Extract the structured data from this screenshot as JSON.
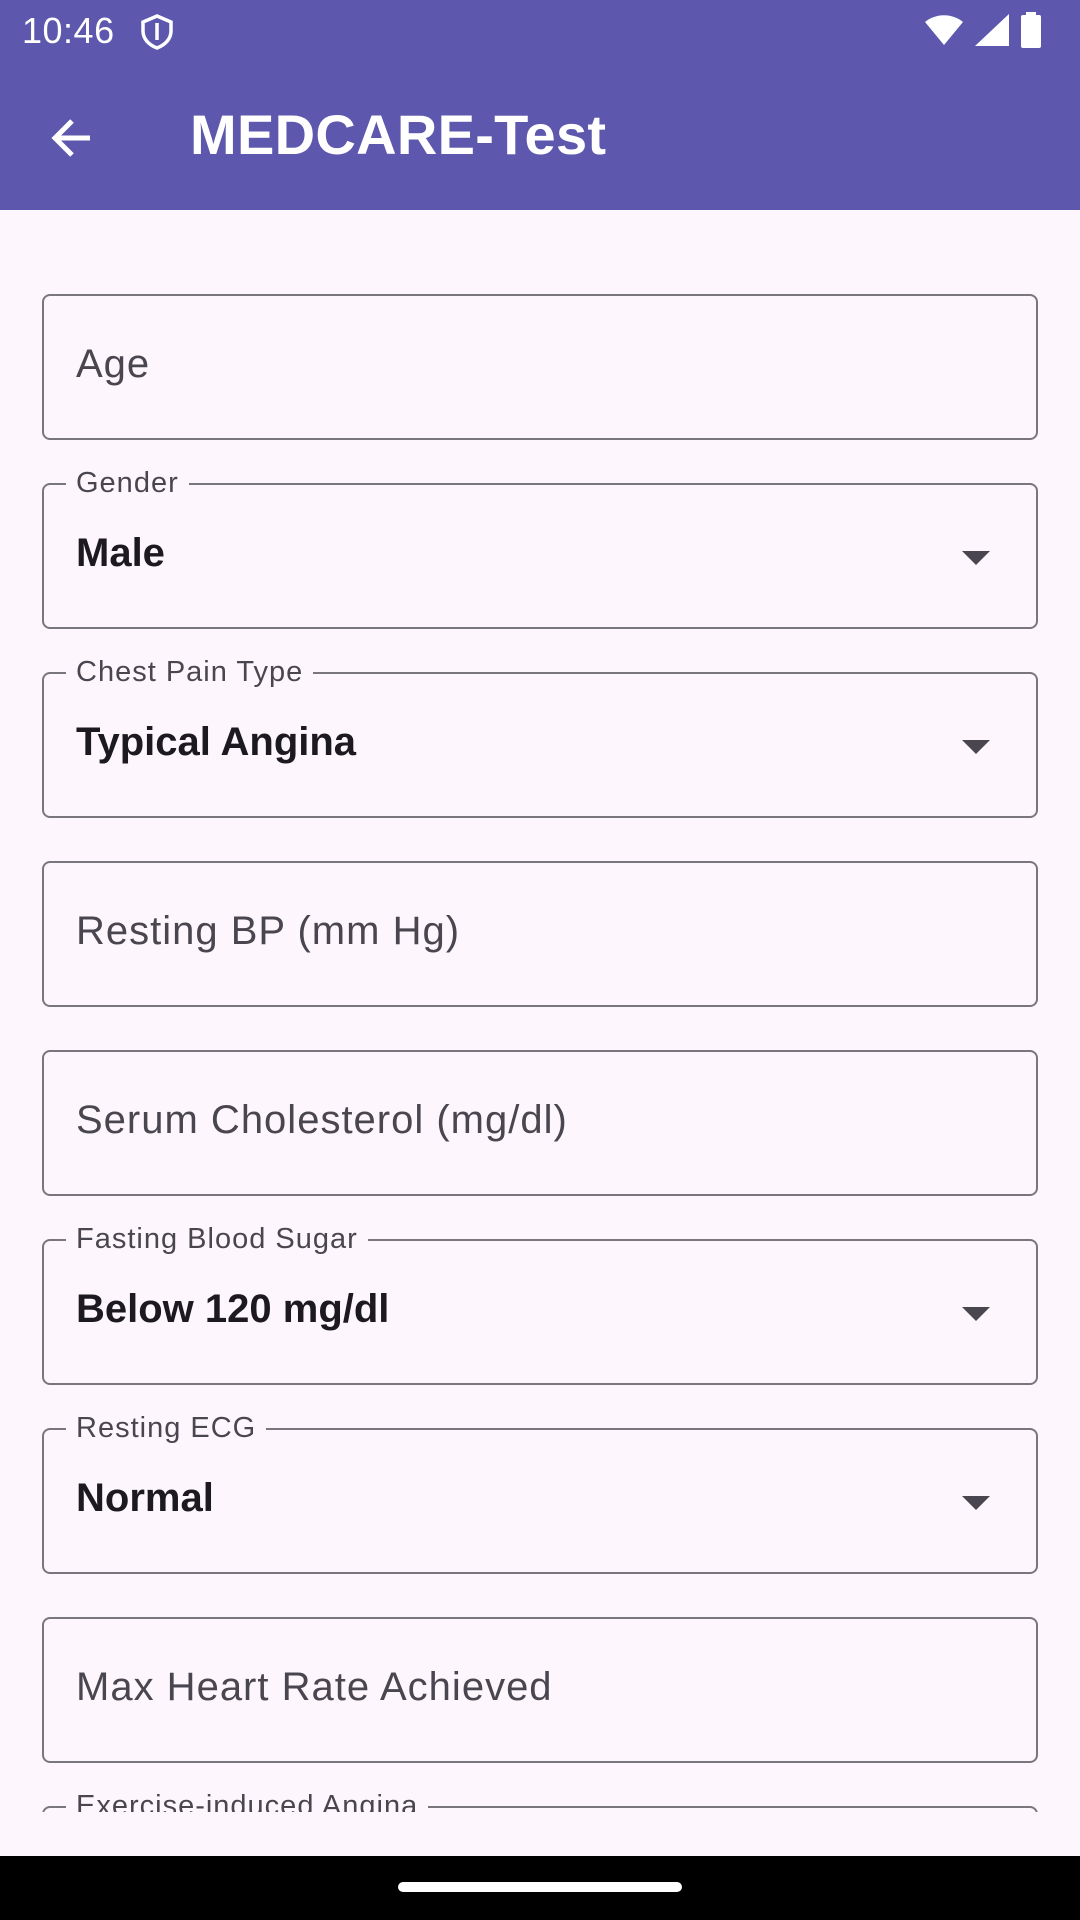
{
  "status_bar": {
    "time": "10:46",
    "icons": [
      "shield-icon",
      "wifi-icon",
      "signal-icon",
      "battery-icon"
    ]
  },
  "app_bar": {
    "back_icon": "arrow-back-icon",
    "title": "MEDCARE-Test"
  },
  "form": {
    "age": {
      "placeholder": "Age"
    },
    "gender": {
      "label": "Gender",
      "value": "Male"
    },
    "chest_pain_type": {
      "label": "Chest Pain Type",
      "value": "Typical Angina"
    },
    "resting_bp": {
      "placeholder": "Resting BP (mm Hg)"
    },
    "serum_cholesterol": {
      "placeholder": "Serum Cholesterol (mg/dl)"
    },
    "fasting_blood_sugar": {
      "label": "Fasting Blood Sugar",
      "value": "Below 120 mg/dl"
    },
    "resting_ecg": {
      "label": "Resting ECG",
      "value": "Normal"
    },
    "max_heart_rate": {
      "placeholder": "Max Heart Rate Achieved"
    },
    "exercise_angina": {
      "label": "Exercise-induced Angina"
    }
  },
  "colors": {
    "primary": "#5d58ad",
    "background": "#fdf7fd",
    "outline": "#79767d",
    "on_surface": "#1c1a20",
    "on_surface_variant": "#4a4650"
  }
}
